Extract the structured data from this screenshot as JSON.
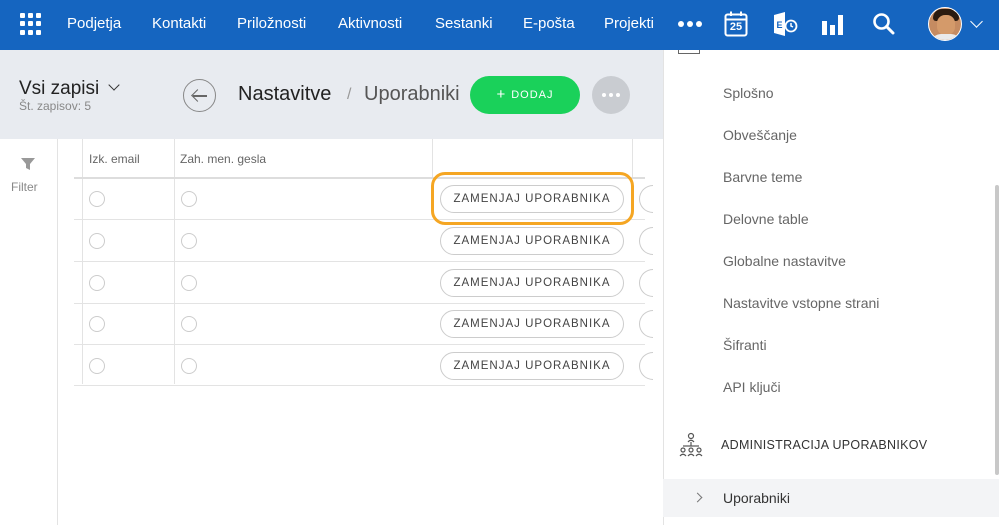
{
  "topnav": {
    "items": [
      {
        "label": "Podjetja"
      },
      {
        "label": "Kontakti"
      },
      {
        "label": "Priložnosti"
      },
      {
        "label": "Aktivnosti"
      },
      {
        "label": "Sestanki"
      },
      {
        "label": "E-pošta"
      },
      {
        "label": "Projekti"
      }
    ],
    "calendar_day": "25",
    "icons": [
      "apps-grid-icon",
      "more-icon",
      "calendar-icon",
      "exchange-icon",
      "reports-icon",
      "search-icon",
      "user-avatar",
      "chevron-down-icon"
    ],
    "bar_color": "#1565c0"
  },
  "view": {
    "title": "Vsi zapisi",
    "count": "Št. zapisov: 5"
  },
  "breadcrumb": {
    "main": "Nastavitve",
    "separator": "/",
    "sub": "Uporabniki"
  },
  "actions": {
    "add_label": "DODAJ",
    "add_color": "#1ad15a"
  },
  "filter": {
    "label": "Filter"
  },
  "table": {
    "headers": [
      "Izk. email",
      "Zah. men. gesla",
      ""
    ],
    "rows": [
      {
        "button": "ZAMENJAJ UPORABNIKA"
      },
      {
        "button": "ZAMENJAJ UPORABNIKA"
      },
      {
        "button": "ZAMENJAJ UPORABNIKA"
      },
      {
        "button": "ZAMENJAJ UPORABNIKA"
      },
      {
        "button": "ZAMENJAJ UPORABNIKA"
      }
    ],
    "highlight_color": "#f5a623"
  },
  "settings_menu": {
    "items": [
      {
        "label": "Splošno"
      },
      {
        "label": "Obveščanje"
      },
      {
        "label": "Barvne teme"
      },
      {
        "label": "Delovne table"
      },
      {
        "label": "Globalne nastavitve"
      },
      {
        "label": "Nastavitve vstopne strani"
      },
      {
        "label": "Šifranti"
      },
      {
        "label": "API ključi"
      }
    ],
    "section_title": "ADMINISTRACIJA UPORABNIKOV",
    "active_item": "Uporabniki"
  }
}
